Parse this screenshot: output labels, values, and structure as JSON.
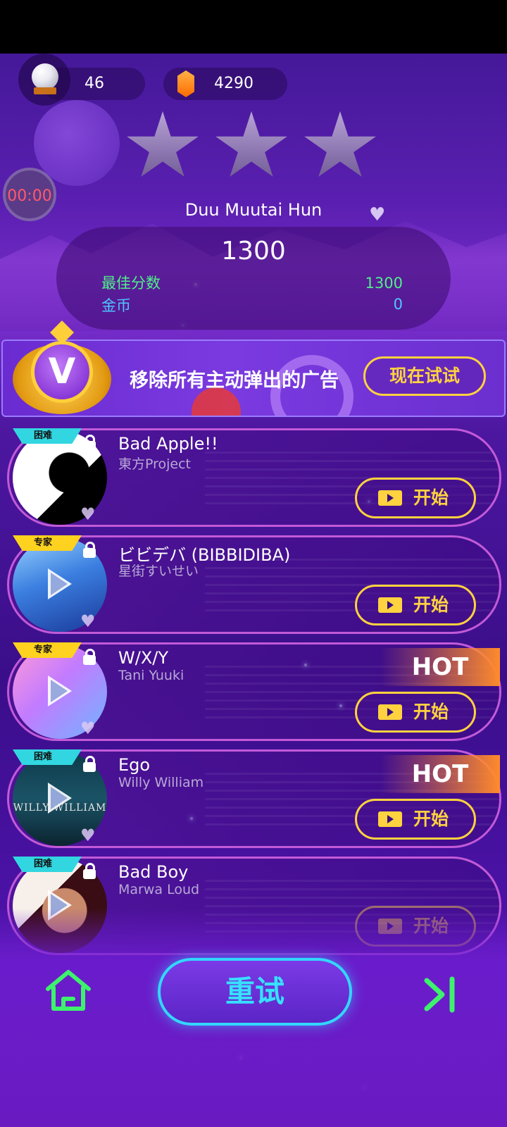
{
  "header": {
    "pearl_count": "46",
    "gem_count": "4290",
    "timer": "00:00"
  },
  "result": {
    "song_name": "Duu Muutai Hun",
    "score": "1300",
    "best_label": "最佳分数",
    "best_value": "1300",
    "coin_label": "金币",
    "coin_value": "0",
    "stars_earned": 0,
    "stars_total": 3
  },
  "banner": {
    "badge_letter": "V",
    "text": "移除所有主动弹出的广告",
    "button": "现在试试"
  },
  "songs": [
    {
      "title": "Bad Apple!!",
      "artist": "東方Project",
      "difficulty": "困难",
      "hot": "",
      "start": "开始"
    },
    {
      "title": "ビビデバ (BIBBIDIBA)",
      "artist": "星街すいせい",
      "difficulty": "专家",
      "hot": "",
      "start": "开始"
    },
    {
      "title": "W/X/Y",
      "artist": "Tani Yuuki",
      "difficulty": "专家",
      "hot": "HOT",
      "start": "开始"
    },
    {
      "title": "Ego",
      "artist": "Willy William",
      "difficulty": "困难",
      "hot": "HOT",
      "start": "开始",
      "cover_text": "WILLY WILLIAM"
    },
    {
      "title": "Bad Boy",
      "artist": "Marwa Loud",
      "difficulty": "困难",
      "hot": "",
      "start": "开始"
    }
  ],
  "footer": {
    "retry": "重试"
  },
  "colors": {
    "accent_yellow": "#ffd23f",
    "retry_cyan": "#37e0ff",
    "best_green": "#4ef08a",
    "coin_blue": "#4fc6ff",
    "hard_tag": "#32d6e0",
    "expert_tag": "#ffd21f",
    "hot_orange": "#ff8a2c"
  }
}
